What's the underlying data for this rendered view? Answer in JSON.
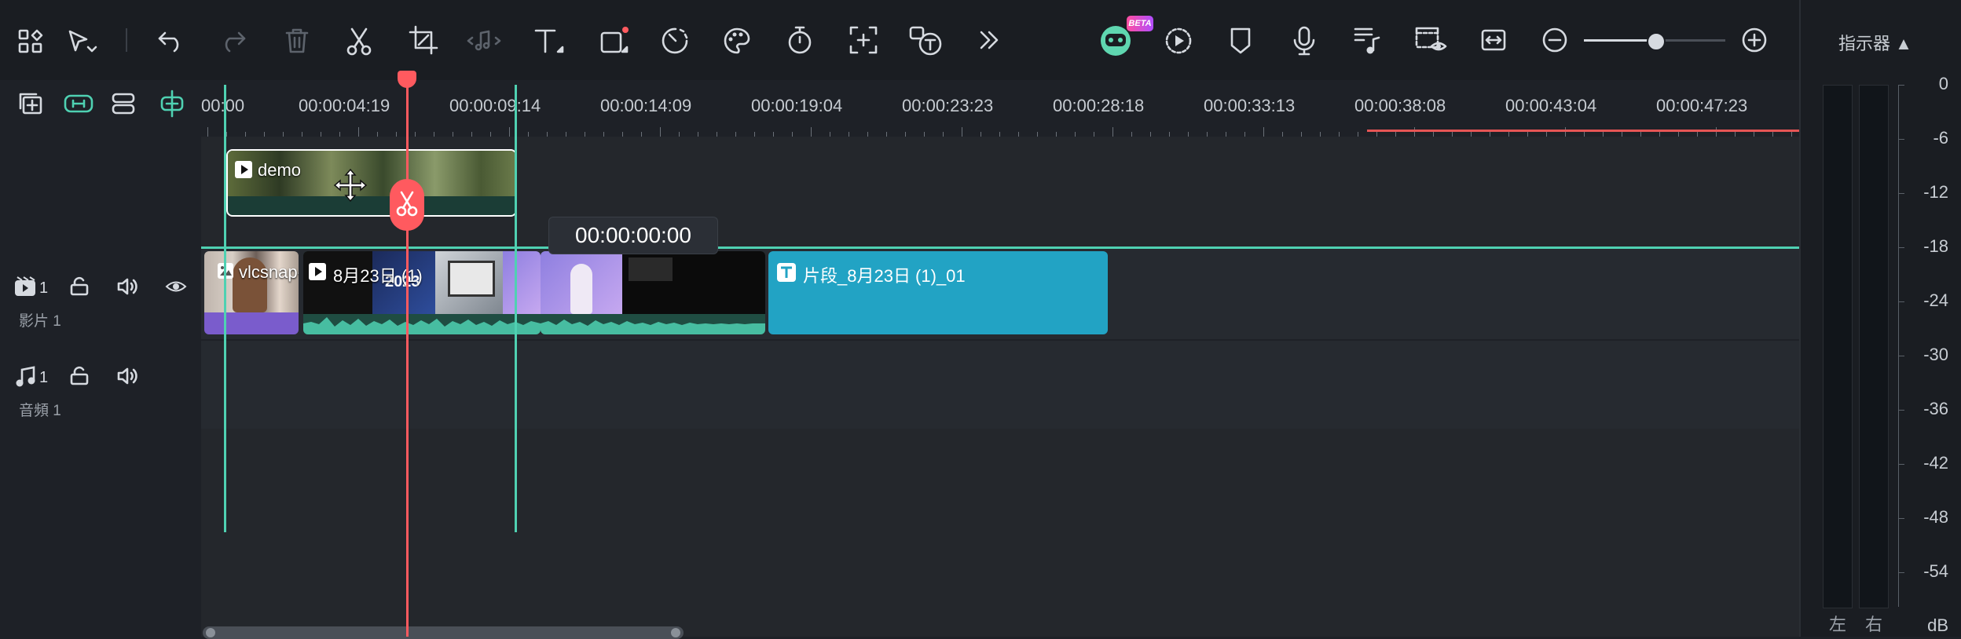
{
  "toolbar": {
    "tools": [
      "layout-icon",
      "select-arrow-icon",
      "undo-icon",
      "redo-icon",
      "delete-icon",
      "scissors-icon",
      "crop-icon",
      "audio-edit-icon",
      "text-icon",
      "shape-icon",
      "speed-icon",
      "color-palette-icon",
      "timer-icon",
      "add-frame-icon",
      "text-to-speech-icon",
      "more-icon"
    ],
    "beta_badge": "BETA",
    "right_tools": [
      "ai-mate-icon",
      "play-preview-icon",
      "marker-icon",
      "microphone-icon",
      "music-list-icon",
      "preview-render-icon",
      "fit-icon",
      "zoom-out-icon",
      "zoom-in-icon"
    ],
    "zoom_level": 0.5
  },
  "ruler": {
    "labels": [
      "00:00",
      "00:00:04:19",
      "00:00:09:14",
      "00:00:14:09",
      "00:00:19:04",
      "00:00:23:23",
      "00:00:28:18",
      "00:00:33:13",
      "00:00:38:08",
      "00:00:43:04",
      "00:00:47:23"
    ]
  },
  "playhead_tooltip": "00:00:00:00",
  "tracks": {
    "video": {
      "number": "1",
      "name": "影片 1"
    },
    "audio": {
      "number": "1",
      "name": "音頻 1"
    }
  },
  "clips": {
    "demo": "demo",
    "vlcsnap": "vlcsnap-err...",
    "aug23": "8月23日 (1)",
    "thumb_text": "2023",
    "text_clip": "片段_8月23日 (1)_01"
  },
  "meter": {
    "title": "指示器 ▲",
    "scale": [
      "0",
      "-6",
      "-12",
      "-18",
      "-24",
      "-30",
      "-36",
      "-42",
      "-48",
      "-54",
      "dB"
    ],
    "left": "左",
    "right": "右"
  },
  "colors": {
    "accent": "#4fd1b2",
    "playhead": "#ff5a5f",
    "text_clip": "#22a3c4",
    "vlcsnap_bar": "#7a5ccc"
  }
}
